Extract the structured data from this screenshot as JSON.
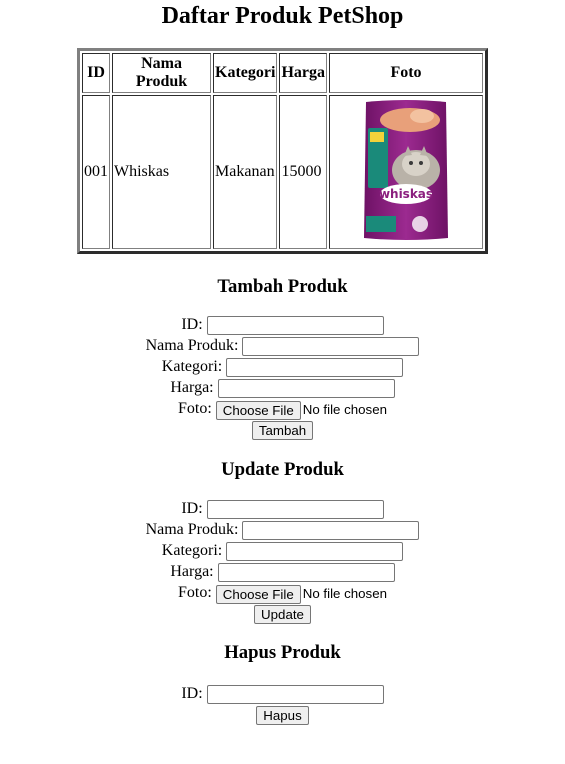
{
  "page": {
    "title": "Daftar Produk PetShop"
  },
  "table": {
    "headers": [
      "ID",
      "Nama Produk",
      "Kategori",
      "Harga",
      "Foto"
    ],
    "rows": [
      {
        "id": "001",
        "nama": "Whiskas",
        "kategori": "Makanan",
        "harga": "15000",
        "foto_label": "whiskas"
      }
    ]
  },
  "forms": {
    "tambah": {
      "heading": "Tambah Produk",
      "id_label": "ID:",
      "nama_label": "Nama Produk:",
      "kategori_label": "Kategori:",
      "harga_label": "Harga:",
      "foto_label": "Foto:",
      "file_button": "Choose File",
      "file_status": "No file chosen",
      "submit_label": "Tambah"
    },
    "update": {
      "heading": "Update Produk",
      "id_label": "ID:",
      "nama_label": "Nama Produk:",
      "kategori_label": "Kategori:",
      "harga_label": "Harga:",
      "foto_label": "Foto:",
      "file_button": "Choose File",
      "file_status": "No file chosen",
      "submit_label": "Update"
    },
    "hapus": {
      "heading": "Hapus Produk",
      "id_label": "ID:",
      "submit_label": "Hapus"
    }
  },
  "colors": {
    "bag_purple": "#8b1f7e",
    "bag_teal": "#1a8a7a"
  }
}
